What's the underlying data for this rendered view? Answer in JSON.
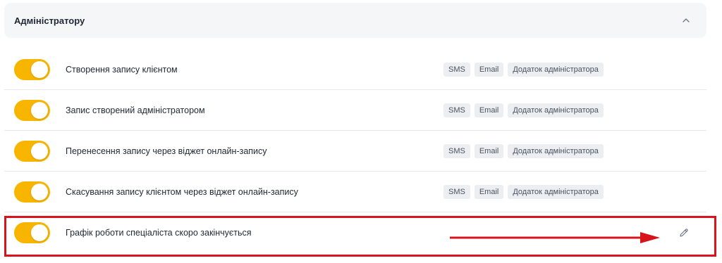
{
  "section": {
    "title": "Адміністратору",
    "chevron_icon": "chevron-up-icon"
  },
  "rows": [
    {
      "label": "Створення запису клієнтом",
      "enabled": true,
      "tags": [
        "SMS",
        "Email",
        "Додаток адміністратора"
      ]
    },
    {
      "label": "Запис створений адміністратором",
      "enabled": true,
      "tags": [
        "SMS",
        "Email",
        "Додаток адміністратора"
      ]
    },
    {
      "label": "Перенесення запису через віджет онлайн-запису",
      "enabled": true,
      "tags": [
        "SMS",
        "Email",
        "Додаток адміністратора"
      ]
    },
    {
      "label": "Скасування запису клієнтом через віджет онлайн-запису",
      "enabled": true,
      "tags": [
        "SMS",
        "Email",
        "Додаток адміністратора"
      ]
    },
    {
      "label": "Графік роботи спеціаліста скоро закінчується",
      "enabled": true,
      "tags": [],
      "action_icon": "pencil-icon",
      "highlighted": true
    }
  ],
  "colors": {
    "toggle_on": "#f7b500",
    "highlight": "#d7141c",
    "tag_bg": "#eceef1"
  }
}
